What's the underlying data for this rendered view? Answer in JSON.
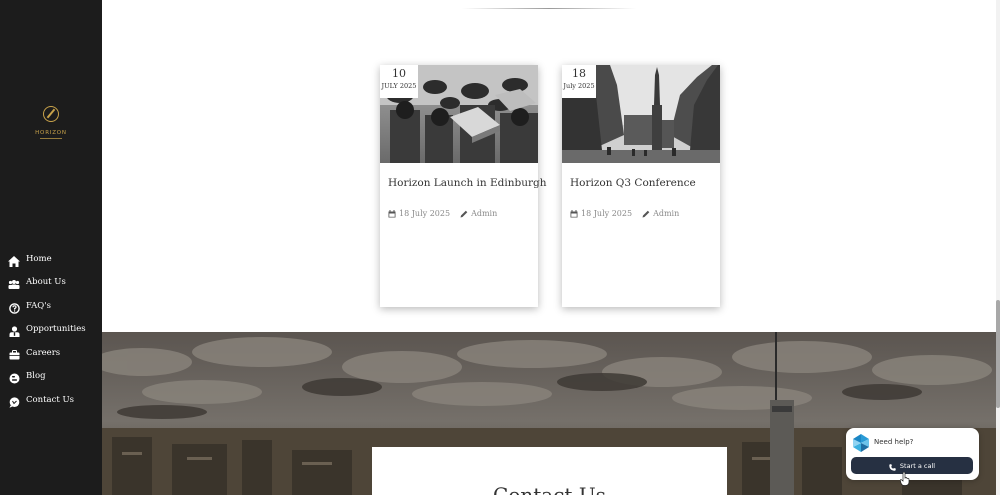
{
  "brand": {
    "name": "HORIZON",
    "accent": "#c8a24a"
  },
  "sidebar": {
    "items": [
      {
        "label": "Home",
        "icon": "home-icon"
      },
      {
        "label": "About Us",
        "icon": "users-icon"
      },
      {
        "label": "FAQ's",
        "icon": "question-icon"
      },
      {
        "label": "Opportunities",
        "icon": "user-tie-icon"
      },
      {
        "label": "Careers",
        "icon": "briefcase-icon"
      },
      {
        "label": "Blog",
        "icon": "blogger-icon"
      },
      {
        "label": "Contact Us",
        "icon": "chat-icon"
      }
    ]
  },
  "posts": [
    {
      "day": "10",
      "month": "JULY 2025",
      "title": "Horizon Launch in Edinburgh",
      "date": "18 July 2025",
      "author": "Admin",
      "image": "graduation-photo"
    },
    {
      "day": "18",
      "month": "July 2025",
      "title": "Horizon Q3 Conference",
      "date": "18 July 2025",
      "author": "Admin",
      "image": "edinburgh-street-photo"
    }
  ],
  "contact": {
    "title": "Contact Us"
  },
  "help_widget": {
    "prompt": "Need help?",
    "button_label": "Start a call"
  },
  "colors": {
    "sidebar_bg": "#1c1c1c",
    "call_button_bg": "#263042"
  }
}
